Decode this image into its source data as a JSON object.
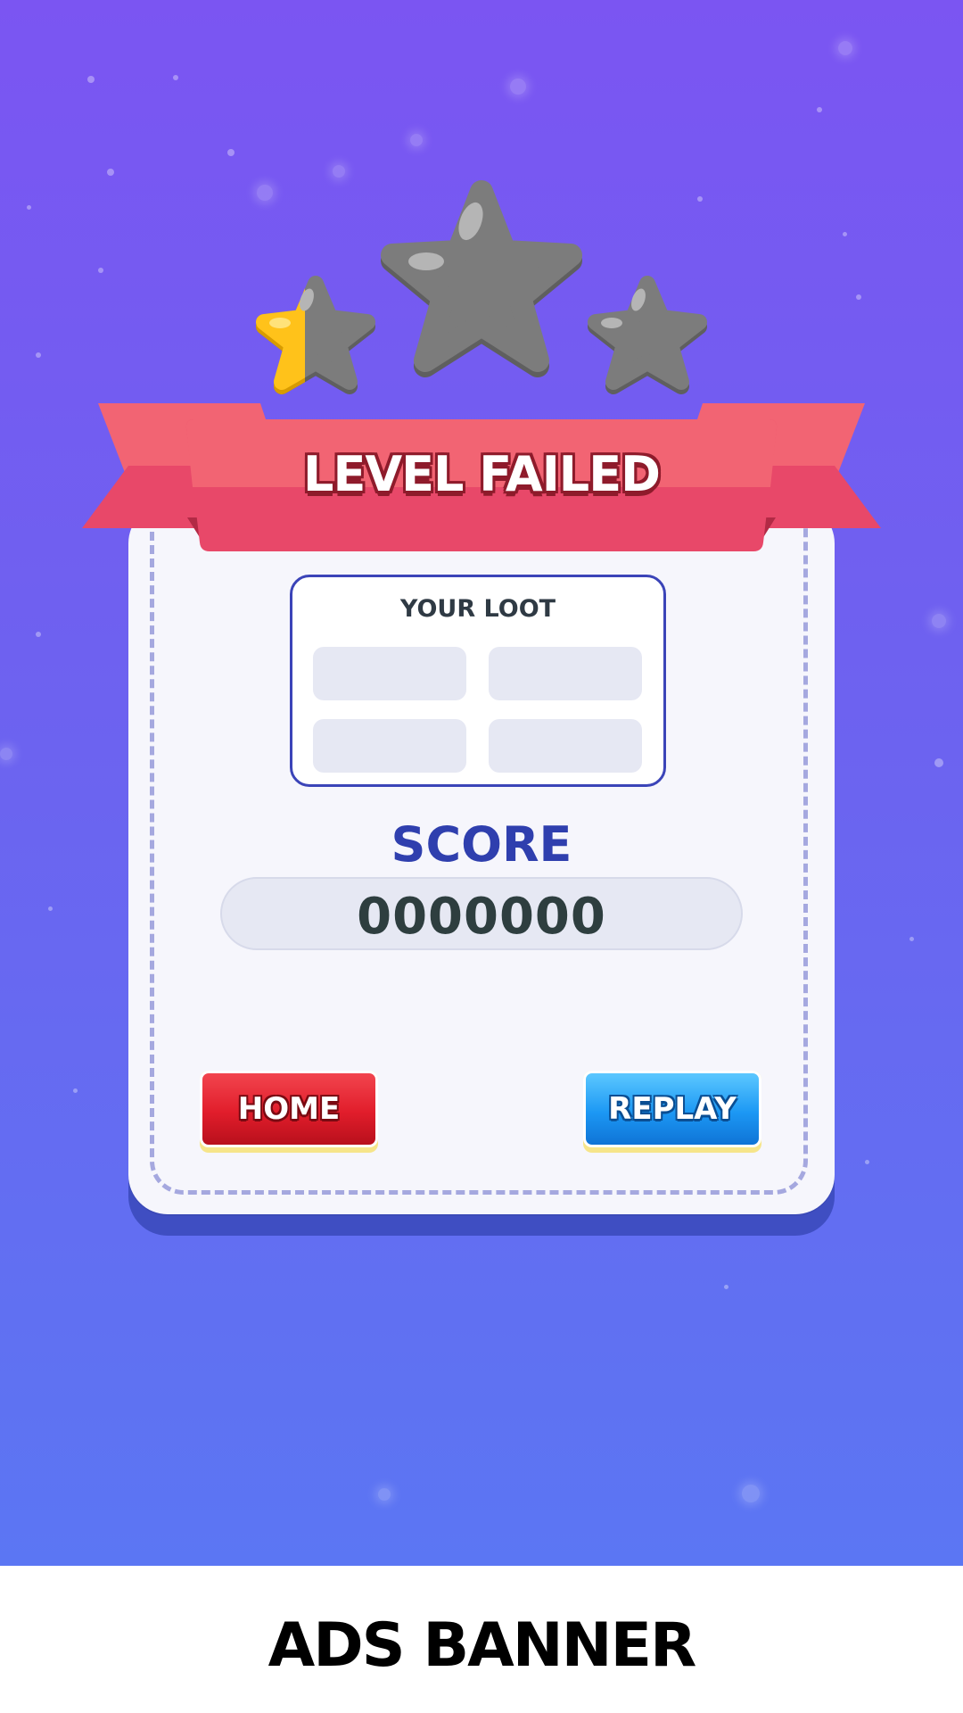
{
  "screen": {
    "title": "LEVEL FAILED",
    "stars_earned_fraction": 0.17,
    "stars_total": 3
  },
  "loot": {
    "title": "YOUR LOOT",
    "slots": [
      "",
      "",
      "",
      ""
    ]
  },
  "score": {
    "label": "SCORE",
    "value": "0000000"
  },
  "buttons": {
    "home_label": "HOME",
    "replay_label": "REPLAY"
  },
  "ads": {
    "label": "ADS BANNER"
  },
  "colors": {
    "background_top": "#7B55F2",
    "background_bottom": "#5B76F3",
    "ribbon": "#F26473",
    "star_empty": "#7C7C7C",
    "star_filled": "#FFC21A",
    "home_button": "#E11D2B",
    "replay_button": "#1C98F4",
    "score_label": "#2F3FAE"
  }
}
